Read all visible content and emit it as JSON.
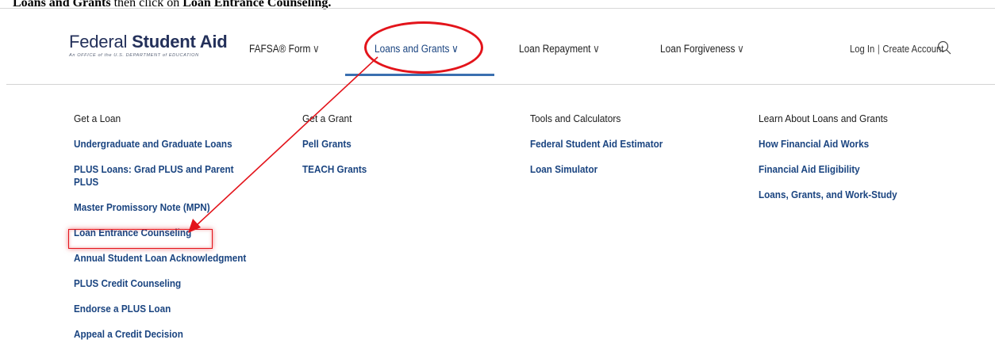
{
  "instruction": {
    "part1": "Loans and Grants",
    "part2": " then click on ",
    "part3": "Loan Entrance Counseling."
  },
  "logo": {
    "word1": "Federal",
    "word2": "Student Aid",
    "subtitle": "An OFFICE of the U.S. DEPARTMENT of EDUCATION"
  },
  "nav": {
    "items": [
      {
        "label": "FAFSA® Form",
        "chevron": "∨"
      },
      {
        "label": "Loans and Grants",
        "chevron": "∨"
      },
      {
        "label": "Loan Repayment",
        "chevron": "∨"
      },
      {
        "label": "Loan Forgiveness",
        "chevron": "∨"
      }
    ],
    "login": "Log In",
    "separator": "|",
    "create_account": "Create Account",
    "active_color": "#1a4480"
  },
  "menu": {
    "columns": [
      {
        "heading": "Get a Loan",
        "links": [
          "Undergraduate and Graduate Loans",
          "PLUS Loans: Grad PLUS and Parent PLUS",
          "Master Promissory Note (MPN)",
          "Loan Entrance Counseling",
          "Annual Student Loan Acknowledgment",
          "PLUS Credit Counseling",
          "Endorse a PLUS Loan",
          "Appeal a Credit Decision"
        ]
      },
      {
        "heading": "Get a Grant",
        "links": [
          "Pell Grants",
          "TEACH Grants"
        ]
      },
      {
        "heading": "Tools and Calculators",
        "links": [
          "Federal Student Aid Estimator",
          "Loan Simulator"
        ]
      },
      {
        "heading": "Learn About Loans and Grants",
        "links": [
          "How Financial Aid Works",
          "Financial Aid Eligibility",
          "Loans, Grants, and Work-Study"
        ]
      }
    ]
  },
  "annotation": {
    "color": "#e3141b",
    "highlighted_item": "Loan Entrance Counseling"
  },
  "icons": {
    "search": "search-icon"
  }
}
